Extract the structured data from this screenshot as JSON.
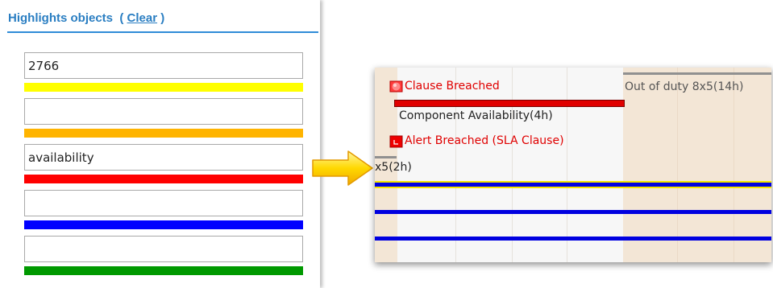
{
  "panel": {
    "title": "Highlights objects",
    "clear_label": "Clear",
    "rows": [
      {
        "value": "2766",
        "bar_color": "#ffff00"
      },
      {
        "value": "",
        "bar_color": "#ffb400"
      },
      {
        "value": "availability",
        "bar_color": "#ff0000"
      },
      {
        "value": "",
        "bar_color": "#0000ff"
      },
      {
        "value": "",
        "bar_color": "#009900"
      }
    ]
  },
  "timeline": {
    "clause_breached": "Clause Breached",
    "out_of_duty": "Out of duty 8x5(14h)",
    "component_availability": "Component Availability(4h)",
    "alert_breached": "Alert Breached (SLA Clause)",
    "duty_label": "x5(2h)",
    "colors": {
      "alert_red": "#e00000",
      "highlight_yellow": "#f5e600",
      "highlight_blue": "#0000e0",
      "off_duty_band": "#f3e6d6",
      "on_duty_band": "#f7f7f7"
    }
  },
  "icons": [
    "clause-breached-icon",
    "alert-breached-icon",
    "arrow-icon"
  ]
}
